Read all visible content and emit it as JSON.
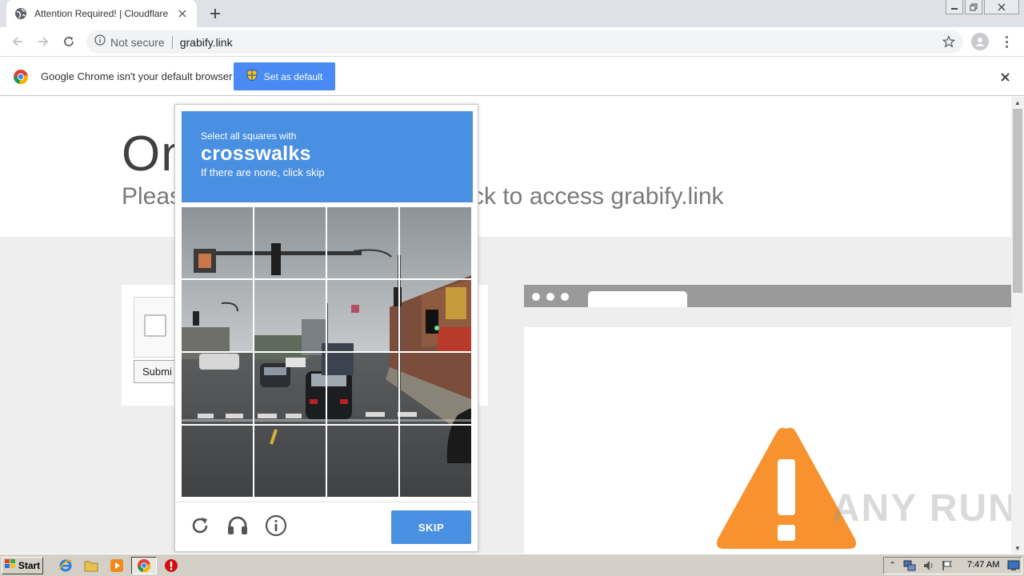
{
  "tab": {
    "title": "Attention Required! | Cloudflare",
    "favicon": "globe-icon"
  },
  "toolbar": {
    "security_label": "Not secure",
    "url": "grabify.link"
  },
  "infobar": {
    "message": "Google Chrome isn't your default browser",
    "button_label": "Set as default"
  },
  "page": {
    "heading_partial": "On",
    "subheading_left": "Pleas",
    "subheading_right": "ck to access grabify.link",
    "submit_partial": "Submi"
  },
  "challenge": {
    "instruction_line1": "Select all squares with",
    "instruction_target": "crosswalks",
    "instruction_line3": "If there are none, click skip",
    "grid_rows": 4,
    "grid_cols": 4,
    "footer_icons": [
      "reload-icon",
      "audio-headphones-icon",
      "info-icon"
    ],
    "skip_label": "SKIP"
  },
  "watermark": "ANY RUN",
  "taskbar": {
    "start_label": "Start",
    "clock": "7:47 AM"
  },
  "colors": {
    "header_blue": "#4a90e2",
    "chrome_button_blue": "#4a8af4",
    "warning_orange": "#f7922f"
  }
}
